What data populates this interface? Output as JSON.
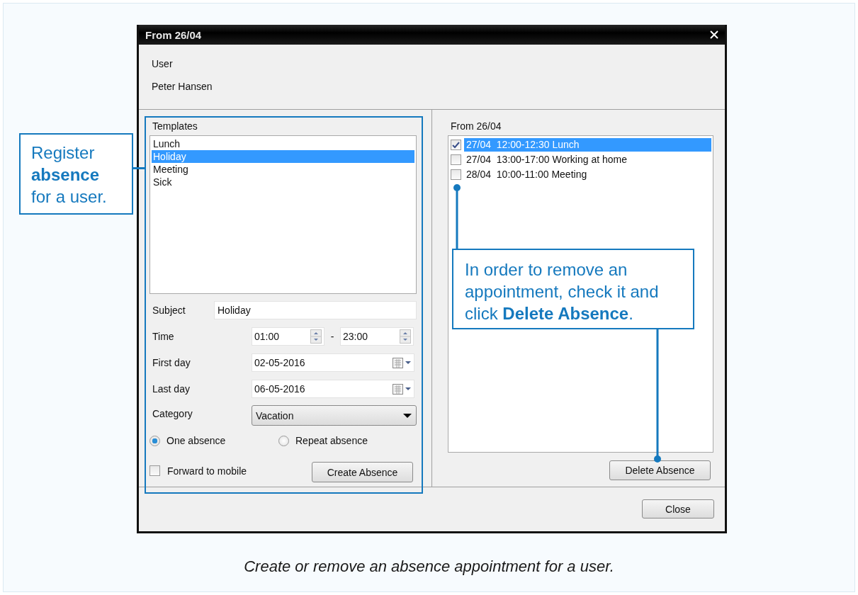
{
  "dialog": {
    "title": "From 26/04",
    "user_label": "User",
    "user_name": "Peter Hansen",
    "templates": {
      "label": "Templates",
      "items": [
        {
          "text": "Lunch",
          "selected": false
        },
        {
          "text": "Holiday",
          "selected": true
        },
        {
          "text": "Meeting",
          "selected": false
        },
        {
          "text": "Sick",
          "selected": false
        }
      ]
    },
    "subject": {
      "label": "Subject",
      "value": "Holiday"
    },
    "time": {
      "label": "Time",
      "start": "01:00",
      "separator": "-",
      "end": "23:00"
    },
    "first_day": {
      "label": "First day",
      "value": "02-05-2016"
    },
    "last_day": {
      "label": "Last day",
      "value": "06-05-2016"
    },
    "category": {
      "label": "Category",
      "value": "Vacation"
    },
    "radios": [
      {
        "label": "One absence",
        "selected": true
      },
      {
        "label": "Repeat absence",
        "selected": false
      }
    ],
    "forward": {
      "label": "Forward to mobile",
      "checked": false
    },
    "create_button": "Create Absence",
    "appointments": {
      "label": "From 26/04",
      "items": [
        {
          "text": "27/04  12:00-12:30 Lunch",
          "checked": true,
          "selected": true
        },
        {
          "text": "27/04  13:00-17:00 Working at home",
          "checked": false,
          "selected": false
        },
        {
          "text": "28/04  10:00-11:00 Meeting",
          "checked": false,
          "selected": false
        }
      ]
    },
    "delete_button": "Delete Absence",
    "close_button": "Close"
  },
  "callouts": [
    {
      "text": "Register **absence** for a user."
    },
    {
      "text": "In order to remove an appointment, check it and click **Delete Absence**."
    }
  ],
  "caption": "Create or remove an absence appointment for a user."
}
